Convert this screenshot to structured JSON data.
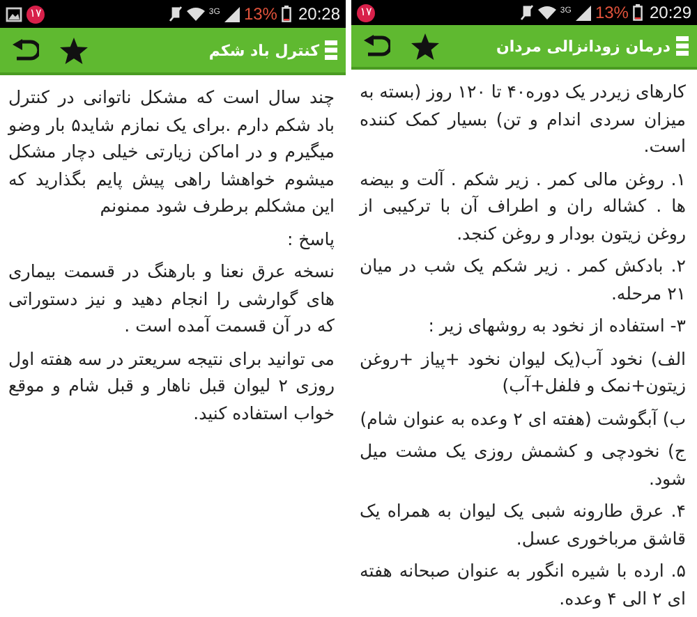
{
  "screens": [
    {
      "status_bar": {
        "image_notification": false,
        "badge": "۱۷",
        "network": "3G",
        "battery": "13%",
        "time": "20:29"
      },
      "toolbar": {
        "title": "درمان زودانزالی مردان"
      },
      "paragraphs": [
        "کارهای زیردر یک دوره۴۰ تا ۱۲۰ روز (بسته به میزان سردی اندام و تن) بسیار کمک کننده است.",
        "۱. روغن مالی کمر . زیر شکم . آلت و بیضه ها . کشاله ران و اطراف آن با ترکیبی از روغن زیتون بودار و روغن کنجد.",
        "۲. بادکش کمر . زیر شکم یک شب در میان ۲۱ مرحله.",
        "۳- استفاده از نخود به روشهای زیر :",
        "الف) نخود آب(یک لیوان نخود +پیاز +روغن زیتون+نمک و فلفل+آب)",
        "ب) آبگوشت (هفته ای ۲ وعده به عنوان شام)",
        "ج) نخودچی و کشمش روزی یک مشت میل شود.",
        "۴. عرق طارونه شبی یک لیوان به همراه یک قاشق مرباخوری عسل.",
        "۵. ارده با شیره انگور به عنوان صبحانه هفته ای ۲ الی ۴ وعده."
      ]
    },
    {
      "status_bar": {
        "image_notification": true,
        "badge": "۱۷",
        "network": "3G",
        "battery": "13%",
        "time": "20:28"
      },
      "toolbar": {
        "title": "کنترل باد شکم"
      },
      "paragraphs": [
        "چند سال است که مشکل ناتوانی در کنترل باد شکم دارم .برای یک نمازم شاید۵ بار وضو میگیرم و در اماکن زیارتی خیلی دچار مشکل میشوم خواهشا راهی پیش پایم بگذارید که این مشکلم برطرف شود ممنونم",
        "پاسخ :",
        "نسخه عرق نعنا و بارهنگ در قسمت بیماری های گوارشی را انجام دهید و نیز دستوراتی که در آن قسمت آمده است .",
        "می توانید برای نتیجه سریعتر در سه هفته اول روزی ۲ لیوان قبل ناهار و قبل شام و موقع خواب استفاده کنید."
      ]
    }
  ]
}
